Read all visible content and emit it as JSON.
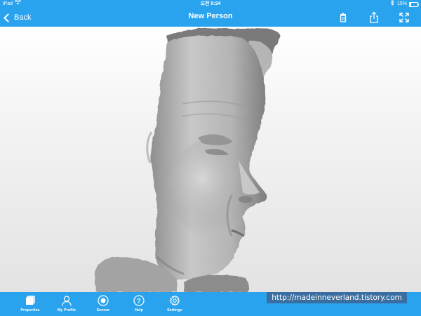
{
  "status_bar": {
    "carrier": "iPad",
    "time": "오전 9:24",
    "battery_percent": "15%",
    "battery_level": 0.15
  },
  "nav_bar": {
    "back_label": "Back",
    "title": "New Person",
    "icons": [
      "trash-icon",
      "share-icon",
      "expand-icon"
    ]
  },
  "tab_bar": {
    "tabs": [
      {
        "label": "Properties",
        "icon": "cube-icon"
      },
      {
        "label": "My Profile",
        "icon": "person-icon"
      },
      {
        "label": "Sensor",
        "icon": "sensor-icon"
      },
      {
        "label": "Help",
        "icon": "help-icon"
      },
      {
        "label": "Settings",
        "icon": "gear-icon"
      }
    ]
  },
  "watermark": "http://madeinneverland.tistory.com",
  "colors": {
    "accent": "#2aa3ef",
    "watermark_bg": "#3b6ea0"
  }
}
